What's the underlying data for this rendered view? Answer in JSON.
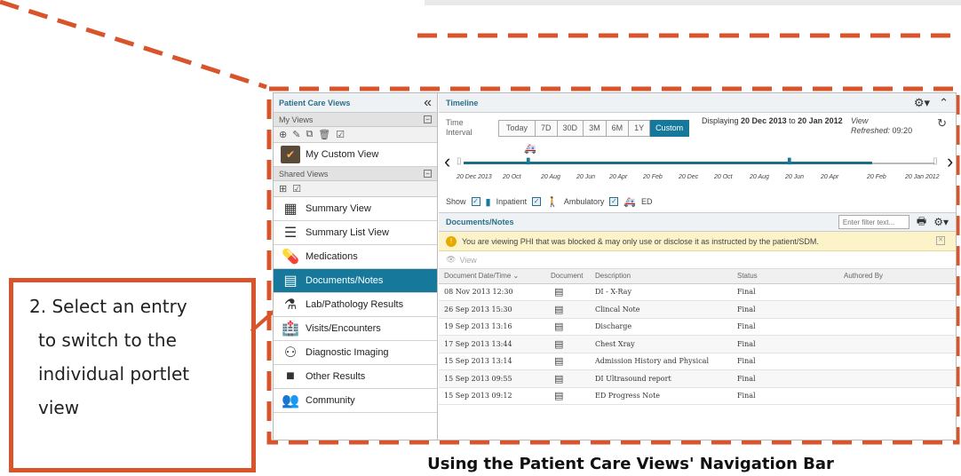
{
  "callout": {
    "lines": [
      "2. Select an entry",
      "to switch to the",
      "individual portlet",
      "view"
    ]
  },
  "caption": "Using the Patient Care Views' Navigation Bar",
  "sidebar": {
    "title": "Patient Care Views",
    "collapse_icon": "«",
    "my_views_label": "My Views",
    "shared_views_label": "Shared Views",
    "items_my": [
      {
        "label": "My Custom View",
        "icon": "custom-view-icon"
      }
    ],
    "items_shared": [
      {
        "label": "Summary View",
        "icon": "grid-icon"
      },
      {
        "label": "Summary List View",
        "icon": "list-icon"
      },
      {
        "label": "Medications",
        "icon": "medications-icon"
      },
      {
        "label": "Documents/Notes",
        "icon": "document-icon",
        "active": true
      },
      {
        "label": "Lab/Pathology Results",
        "icon": "flask-icon"
      },
      {
        "label": "Visits/Encounters",
        "icon": "building-icon"
      },
      {
        "label": "Diagnostic Imaging",
        "icon": "imaging-icon"
      },
      {
        "label": "Other Results",
        "icon": "folder-icon"
      },
      {
        "label": "Community",
        "icon": "community-icon"
      }
    ]
  },
  "timeline": {
    "title": "Timeline",
    "time_interval_label": [
      "Time",
      "Interval"
    ],
    "ranges": [
      "Today",
      "7D",
      "30D",
      "3M",
      "6M",
      "1Y",
      "Custom"
    ],
    "selected_range": "Custom",
    "displaying_prefix": "Displaying",
    "display_from": "20 Dec 2013",
    "display_to_word": "to",
    "display_to": "20 Jan 2012",
    "view_label": "View",
    "refreshed_label": "Refreshed:",
    "refreshed_time": "09:20",
    "ticks": [
      "20 Dec 2013",
      "20 Oct",
      "20 Aug",
      "20 Jun",
      "20 Apr",
      "20 Feb",
      "20 Dec",
      "20 Oct",
      "20 Aug",
      "20 Jun",
      "20 Apr",
      "20 Feb",
      "20 Jan 2012"
    ],
    "show_label": "Show",
    "filters": [
      {
        "label": "Inpatient",
        "icon": "inpatient-icon",
        "checked": true
      },
      {
        "label": "Ambulatory",
        "icon": "ambulatory-icon",
        "checked": true
      },
      {
        "label": "ED",
        "icon": "ambulance-icon",
        "checked": true
      }
    ]
  },
  "documents": {
    "title": "Documents/Notes",
    "filter_placeholder": "Enter filter text...",
    "phi_notice": "You are viewing PHI that was blocked & may only use or disclose it as instructed by the patient/SDM.",
    "view_button": "View",
    "columns": [
      "Document Date/Time",
      "Document",
      "Description",
      "Status",
      "Authored By"
    ],
    "rows": [
      {
        "date": "08 Nov 2013 12:30",
        "description": "DI - X-Ray",
        "status": "Final",
        "author": ""
      },
      {
        "date": "26 Sep 2013 15:30",
        "description": "Clincal Note",
        "status": "Final",
        "author": ""
      },
      {
        "date": "19 Sep 2013 13:16",
        "description": "Discharge",
        "status": "Final",
        "author": ""
      },
      {
        "date": "17 Sep 2013 13:44",
        "description": "Chest Xray",
        "status": "Final",
        "author": ""
      },
      {
        "date": "15 Sep 2013 13:14",
        "description": "Admission History and Physical",
        "status": "Final",
        "author": ""
      },
      {
        "date": "15 Sep 2013 09:55",
        "description": "DI Ultrasound report",
        "status": "Final",
        "author": ""
      },
      {
        "date": "15 Sep 2013 09:12",
        "description": "ED Progress Note",
        "status": "Final",
        "author": ""
      }
    ]
  },
  "colors": {
    "accent": "#16799c",
    "dash": "#d9532b",
    "phi_bg": "#fdf3c9"
  }
}
